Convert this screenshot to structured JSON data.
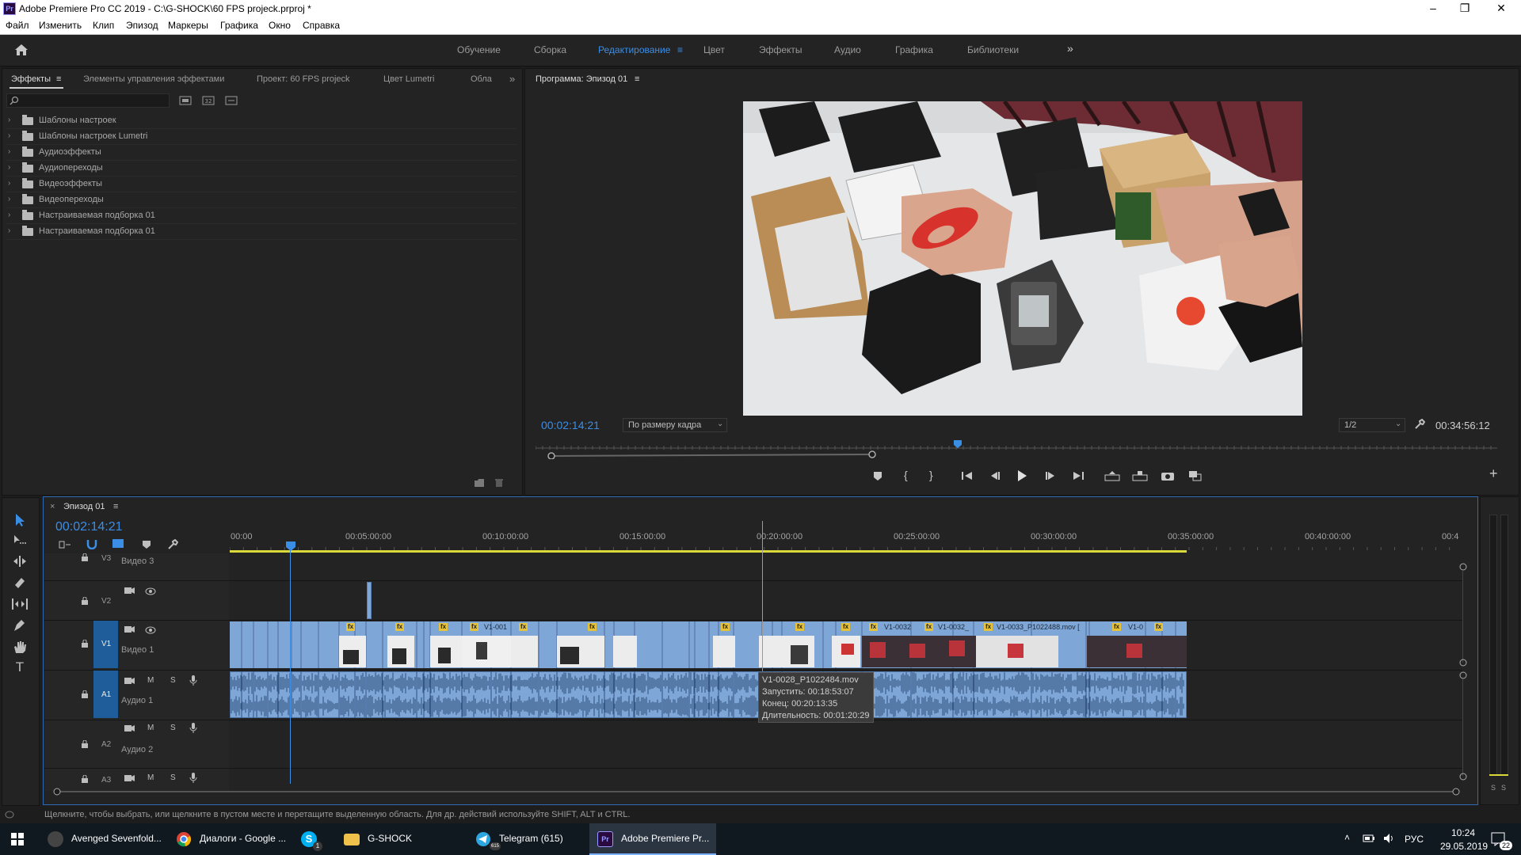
{
  "titlebar": {
    "app_icon": "Pr",
    "title": "Adobe Premiere Pro CC 2019 - C:\\G-SHOCK\\60 FPS projeck.prproj *",
    "minimize": "–",
    "restore": "❐",
    "close": "✕"
  },
  "menu": [
    "Файл",
    "Изменить",
    "Клип",
    "Эпизод",
    "Маркеры",
    "Графика",
    "Окно",
    "Справка"
  ],
  "workspaces": {
    "tabs": [
      "Обучение",
      "Сборка",
      "Редактирование",
      "Цвет",
      "Эффекты",
      "Аудио",
      "Графика",
      "Библиотеки"
    ],
    "active": "Редактирование",
    "more": "»",
    "menu_icon": "≡"
  },
  "effects_panel": {
    "tabs": [
      "Эффекты",
      "Элементы управления эффектами",
      "Проект: 60 FPS projeck",
      "Цвет Lumetri",
      "Обла"
    ],
    "active_tab": "Эффекты",
    "overflow": "»",
    "menu_icon": "≡",
    "search_placeholder": "",
    "items": [
      "Шаблоны настроек",
      "Шаблоны настроек Lumetri",
      "Аудиоэффекты",
      "Аудиопереходы",
      "Видеоэффекты",
      "Видеопереходы",
      "Настраиваемая подборка 01",
      "Настраиваемая подборка 01"
    ]
  },
  "program_monitor": {
    "tab": "Программа: Эпизод 01",
    "menu_icon": "≡",
    "current_time": "00:02:14:21",
    "fit": "По размеру кадра",
    "resolution": "1/2",
    "duration": "00:34:56:12",
    "playhead_fraction": 0.064,
    "controls": [
      "marker-icon",
      "in-point-icon",
      "out-point-icon",
      "go-to-in-icon",
      "step-back-icon",
      "play-icon",
      "step-forward-icon",
      "go-to-out-icon",
      "lift-icon",
      "extract-icon",
      "export-frame-icon",
      "compare-icon"
    ],
    "add_button": "+"
  },
  "timeline": {
    "tab": "Эпизод 01",
    "close": "×",
    "menu_icon": "≡",
    "current_time": "00:02:14:21",
    "ruler": [
      "00:00",
      "00:05:00:00",
      "00:10:00:00",
      "00:15:00:00",
      "00:20:00:00",
      "00:25:00:00",
      "00:30:00:00",
      "00:35:00:00",
      "00:40:00:00",
      "00:4"
    ],
    "tracks": [
      {
        "id": "V3",
        "name": "Видео 3"
      },
      {
        "id": "V2",
        "name": ""
      },
      {
        "id": "V1",
        "name": "Видео 1"
      },
      {
        "id": "A1",
        "name": "Аудио 1"
      },
      {
        "id": "A2",
        "name": "Аудио 2"
      },
      {
        "id": "A3",
        "name": ""
      }
    ],
    "track_buttons": {
      "mute": "M",
      "solo": "S"
    },
    "clip_labels": [
      "V1-001",
      "V1-0032",
      "V1-0032_",
      "V1-0033_P1022488.mov [",
      "V1-0"
    ],
    "fx_badge": "fx",
    "tooltip": {
      "name": "V1-0028_P1022484.mov",
      "start": "Запустить: 00:18:53:07",
      "end": "Конец: 00:20:13:35",
      "duration": "Длительность: 00:01:20:29"
    }
  },
  "meter_labels": [
    "S",
    "S"
  ],
  "status_bar": "Щелкните, чтобы выбрать, или щелкните в пустом месте и перетащите выделенную область. Для др. действий используйте SHIFT, ALT и CTRL.",
  "taskbar": {
    "items": [
      {
        "label": "Avenged Sevenfold...",
        "icon": "wolf-icon"
      },
      {
        "label": "Диалоги - Google ...",
        "icon": "chrome-icon"
      },
      {
        "label": "",
        "icon": "skype-icon"
      },
      {
        "label": "G-SHOCK",
        "icon": "folder-icon"
      },
      {
        "label": "Telegram (615)",
        "icon": "telegram-icon"
      },
      {
        "label": "Adobe Premiere Pr...",
        "icon": "premiere-icon"
      }
    ],
    "skype_badge": "1",
    "telegram_badge": "615",
    "tray": {
      "lang": "РУС",
      "time": "10:24",
      "date": "29.05.2019",
      "notifications": "22"
    }
  }
}
